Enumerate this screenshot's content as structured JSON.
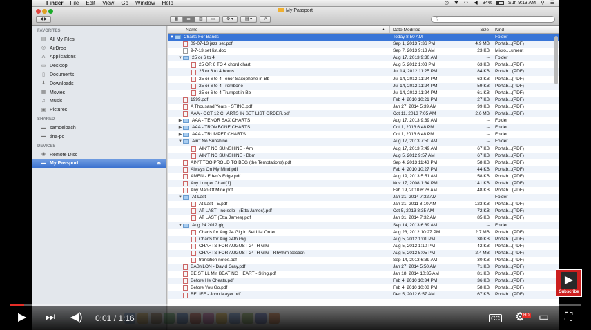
{
  "menubar": {
    "apple": "",
    "items": [
      "Finder",
      "File",
      "Edit",
      "View",
      "Go",
      "Window",
      "Help"
    ],
    "battery": "34%",
    "clock": "Sun 9:13 AM"
  },
  "window": {
    "title": "My Passport",
    "search_placeholder": ""
  },
  "sidebar": {
    "favorites_header": "FAVORITES",
    "favorites": [
      {
        "label": "All My Files",
        "icon": "all-files-icon",
        "glyph": "▤"
      },
      {
        "label": "AirDrop",
        "icon": "airdrop-icon",
        "glyph": "◎"
      },
      {
        "label": "Applications",
        "icon": "applications-icon",
        "glyph": "A"
      },
      {
        "label": "Desktop",
        "icon": "desktop-icon",
        "glyph": "▭"
      },
      {
        "label": "Documents",
        "icon": "documents-icon",
        "glyph": "▯"
      },
      {
        "label": "Downloads",
        "icon": "downloads-icon",
        "glyph": "⬇"
      },
      {
        "label": "Movies",
        "icon": "movies-icon",
        "glyph": "▦"
      },
      {
        "label": "Music",
        "icon": "music-icon",
        "glyph": "♫"
      },
      {
        "label": "Pictures",
        "icon": "pictures-icon",
        "glyph": "▣"
      }
    ],
    "shared_header": "SHARED",
    "shared": [
      {
        "label": "samdeloach",
        "icon": "computer-icon",
        "glyph": "▬"
      },
      {
        "label": "tina-pc",
        "icon": "computer-icon",
        "glyph": "▬"
      }
    ],
    "devices_header": "DEVICES",
    "devices": [
      {
        "label": "Remote Disc",
        "icon": "disc-icon",
        "glyph": "◉"
      },
      {
        "label": "My Passport",
        "icon": "external-drive-icon",
        "glyph": "▬",
        "eject": "⏏"
      }
    ]
  },
  "columns": {
    "name": "Name",
    "date": "Date Modified",
    "size": "Size",
    "kind": "Kind"
  },
  "rows": [
    {
      "indent": 0,
      "disc": "▼",
      "type": "folder",
      "name": "Charts For Bands",
      "date": "Today 8:50 AM",
      "size": "--",
      "kind": "Folder",
      "selected": true
    },
    {
      "indent": 1,
      "disc": "",
      "type": "pdf",
      "name": "09-07-13 jazz set.pdf",
      "date": "Sep 1, 2013 7:36 PM",
      "size": "4.9 MB",
      "kind": "Portab...(PDF)"
    },
    {
      "indent": 1,
      "disc": "",
      "type": "doc",
      "name": "9-7-13 set list.doc",
      "date": "Sep 7, 2013 9:13 AM",
      "size": "23 KB",
      "kind": "Micro....ument"
    },
    {
      "indent": 1,
      "disc": "▼",
      "type": "folder",
      "name": "25 or 6 to 4",
      "date": "Aug 17, 2013 9:30 AM",
      "size": "--",
      "kind": "Folder"
    },
    {
      "indent": 2,
      "disc": "",
      "type": "pdf",
      "name": "25 OR 6 TO 4 chord chart",
      "date": "Aug 5, 2012 1:03 PM",
      "size": "63 KB",
      "kind": "Portab...(PDF)"
    },
    {
      "indent": 2,
      "disc": "",
      "type": "pdf",
      "name": "25 or 6 to 4 horns",
      "date": "Jul 14, 2012 11:25 PM",
      "size": "84 KB",
      "kind": "Portab...(PDF)"
    },
    {
      "indent": 2,
      "disc": "",
      "type": "pdf",
      "name": "25 or 6 to 4 Tenor Saxophone in Bb",
      "date": "Jul 14, 2012 11:24 PM",
      "size": "63 KB",
      "kind": "Portab...(PDF)"
    },
    {
      "indent": 2,
      "disc": "",
      "type": "pdf",
      "name": "25 or 6 to 4 Trombone",
      "date": "Jul 14, 2012 11:24 PM",
      "size": "59 KB",
      "kind": "Portab...(PDF)"
    },
    {
      "indent": 2,
      "disc": "",
      "type": "pdf",
      "name": "25 or 6 to 4 Trumpet in Bb",
      "date": "Jul 14, 2012 11:24 PM",
      "size": "61 KB",
      "kind": "Portab...(PDF)"
    },
    {
      "indent": 1,
      "disc": "",
      "type": "pdf",
      "name": "1999.pdf",
      "date": "Feb 4, 2010 10:21 PM",
      "size": "27 KB",
      "kind": "Portab...(PDF)"
    },
    {
      "indent": 1,
      "disc": "",
      "type": "pdf",
      "name": "A Thousand Years - STING.pdf",
      "date": "Jan 27, 2014 5:39 AM",
      "size": "99 KB",
      "kind": "Portab...(PDF)"
    },
    {
      "indent": 1,
      "disc": "",
      "type": "pdf",
      "name": "AAA - OCT 12 CHARTS IN SET LIST ORDER.pdf",
      "date": "Oct 11, 2013 7:05 AM",
      "size": "2.6 MB",
      "kind": "Portab...(PDF)"
    },
    {
      "indent": 1,
      "disc": "▶",
      "type": "folder",
      "name": "AAA - TENOR SAX CHARTS",
      "date": "Aug 17, 2013 9:39 AM",
      "size": "--",
      "kind": "Folder"
    },
    {
      "indent": 1,
      "disc": "▶",
      "type": "folder",
      "name": "AAA - TROMBONE CHARTS",
      "date": "Oct 1, 2013 6:48 PM",
      "size": "--",
      "kind": "Folder"
    },
    {
      "indent": 1,
      "disc": "▶",
      "type": "folder",
      "name": "AAA - TRUMPET CHARTS",
      "date": "Oct 1, 2013 6:48 PM",
      "size": "--",
      "kind": "Folder"
    },
    {
      "indent": 1,
      "disc": "▼",
      "type": "folder",
      "name": "Ain't No Sunshine",
      "date": "Aug 17, 2013 7:50 AM",
      "size": "--",
      "kind": "Folder"
    },
    {
      "indent": 2,
      "disc": "",
      "type": "pdf",
      "name": "AIN'T NO SUNSHINE - Am",
      "date": "Aug 17, 2013 7:49 AM",
      "size": "67 KB",
      "kind": "Portab...(PDF)"
    },
    {
      "indent": 2,
      "disc": "",
      "type": "pdf",
      "name": "AIN'T NO SUNSHINE - Bbm",
      "date": "Aug 5, 2012 9:57 AM",
      "size": "67 KB",
      "kind": "Portab...(PDF)"
    },
    {
      "indent": 1,
      "disc": "",
      "type": "pdf",
      "name": "AIN'T TOO PROUD TO BEG (the Temptations).pdf",
      "date": "Sep 4, 2013 11:43 PM",
      "size": "58 KB",
      "kind": "Portab...(PDF)"
    },
    {
      "indent": 1,
      "disc": "",
      "type": "pdf",
      "name": "Always On My Mind.pdf",
      "date": "Feb 4, 2010 10:27 PM",
      "size": "44 KB",
      "kind": "Portab...(PDF)"
    },
    {
      "indent": 1,
      "disc": "",
      "type": "pdf",
      "name": "AMEN - Eden's Edge.pdf",
      "date": "Aug 19, 2013 5:51 AM",
      "size": "58 KB",
      "kind": "Portab...(PDF)"
    },
    {
      "indent": 1,
      "disc": "",
      "type": "pdf",
      "name": "Any Longer Chart[1]",
      "date": "Nov 17, 2008 1:34 PM",
      "size": "141 KB",
      "kind": "Portab...(PDF)"
    },
    {
      "indent": 1,
      "disc": "",
      "type": "pdf",
      "name": "Any Man Of Mine.pdf",
      "date": "Feb 19, 2010 6:28 AM",
      "size": "48 KB",
      "kind": "Portab...(PDF)"
    },
    {
      "indent": 1,
      "disc": "▼",
      "type": "folder",
      "name": "At Last",
      "date": "Jan 31, 2014 7:32 AM",
      "size": "--",
      "kind": "Folder"
    },
    {
      "indent": 2,
      "disc": "",
      "type": "pdf",
      "name": "At Last - E.pdf",
      "date": "Jan 31, 2011 8:10 AM",
      "size": "123 KB",
      "kind": "Portab...(PDF)"
    },
    {
      "indent": 2,
      "disc": "",
      "type": "pdf",
      "name": "AT LAST - no solo - (Etta James).pdf",
      "date": "Oct 5, 2013 8:35 AM",
      "size": "72 KB",
      "kind": "Portab...(PDF)"
    },
    {
      "indent": 2,
      "disc": "",
      "type": "pdf",
      "name": "AT LAST (Etta James).pdf",
      "date": "Jan 31, 2014 7:32 AM",
      "size": "85 KB",
      "kind": "Portab...(PDF)"
    },
    {
      "indent": 1,
      "disc": "▼",
      "type": "folder",
      "name": "Aug 24 2012 gig",
      "date": "Sep 14, 2013 6:39 AM",
      "size": "--",
      "kind": "Folder"
    },
    {
      "indent": 2,
      "disc": "",
      "type": "pdf",
      "name": "Charts for Aug 24 Gig in Set List Order",
      "date": "Aug 23, 2012 10:27 PM",
      "size": "2.7 MB",
      "kind": "Portab...(PDF)"
    },
    {
      "indent": 2,
      "disc": "",
      "type": "pdf",
      "name": "Charts for Aug 24th Gig",
      "date": "Aug 5, 2012 1:01 PM",
      "size": "30 KB",
      "kind": "Portab...(PDF)"
    },
    {
      "indent": 2,
      "disc": "",
      "type": "pdf",
      "name": "CHARTS FOR AUGUST 24TH GIG",
      "date": "Aug 5, 2012 1:10 PM",
      "size": "42 KB",
      "kind": "Portab...(PDF)"
    },
    {
      "indent": 2,
      "disc": "",
      "type": "pdf",
      "name": "CHARTS FOR AUGUST 24TH GIG - Rhythm Section",
      "date": "Aug 5, 2012 5:05 PM",
      "size": "2.4 MB",
      "kind": "Portab...(PDF)"
    },
    {
      "indent": 2,
      "disc": "",
      "type": "pdf",
      "name": "transition notes.pdf",
      "date": "Sep 14, 2013 6:39 AM",
      "size": "30 KB",
      "kind": "Portab...(PDF)"
    },
    {
      "indent": 1,
      "disc": "",
      "type": "pdf",
      "name": "BABYLON - David Gray.pdf",
      "date": "Jan 27, 2014 5:50 AM",
      "size": "71 KB",
      "kind": "Portab...(PDF)"
    },
    {
      "indent": 1,
      "disc": "",
      "type": "pdf",
      "name": "BE STILL MY BEATING HEART - Sting.pdf",
      "date": "Jan 18, 2014 10:35 AM",
      "size": "81 KB",
      "kind": "Portab...(PDF)"
    },
    {
      "indent": 1,
      "disc": "",
      "type": "pdf",
      "name": "Before He Cheats.pdf",
      "date": "Feb 4, 2010 10:34 PM",
      "size": "36 KB",
      "kind": "Portab...(PDF)"
    },
    {
      "indent": 1,
      "disc": "",
      "type": "pdf",
      "name": "Before You Go.pdf",
      "date": "Feb 4, 2010 10:08 PM",
      "size": "58 KB",
      "kind": "Portab...(PDF)"
    },
    {
      "indent": 1,
      "disc": "",
      "type": "pdf",
      "name": "BELIEF - John Mayer.pdf",
      "date": "Dec 5, 2012 6:57 AM",
      "size": "67 KB",
      "kind": "Portab...(PDF)"
    }
  ],
  "video": {
    "progress": 0.009,
    "time": "0:01 / 1:16",
    "hd": "HD",
    "cc": "CC",
    "subscribe": "Subscribe",
    "accent": "#e52d27"
  }
}
